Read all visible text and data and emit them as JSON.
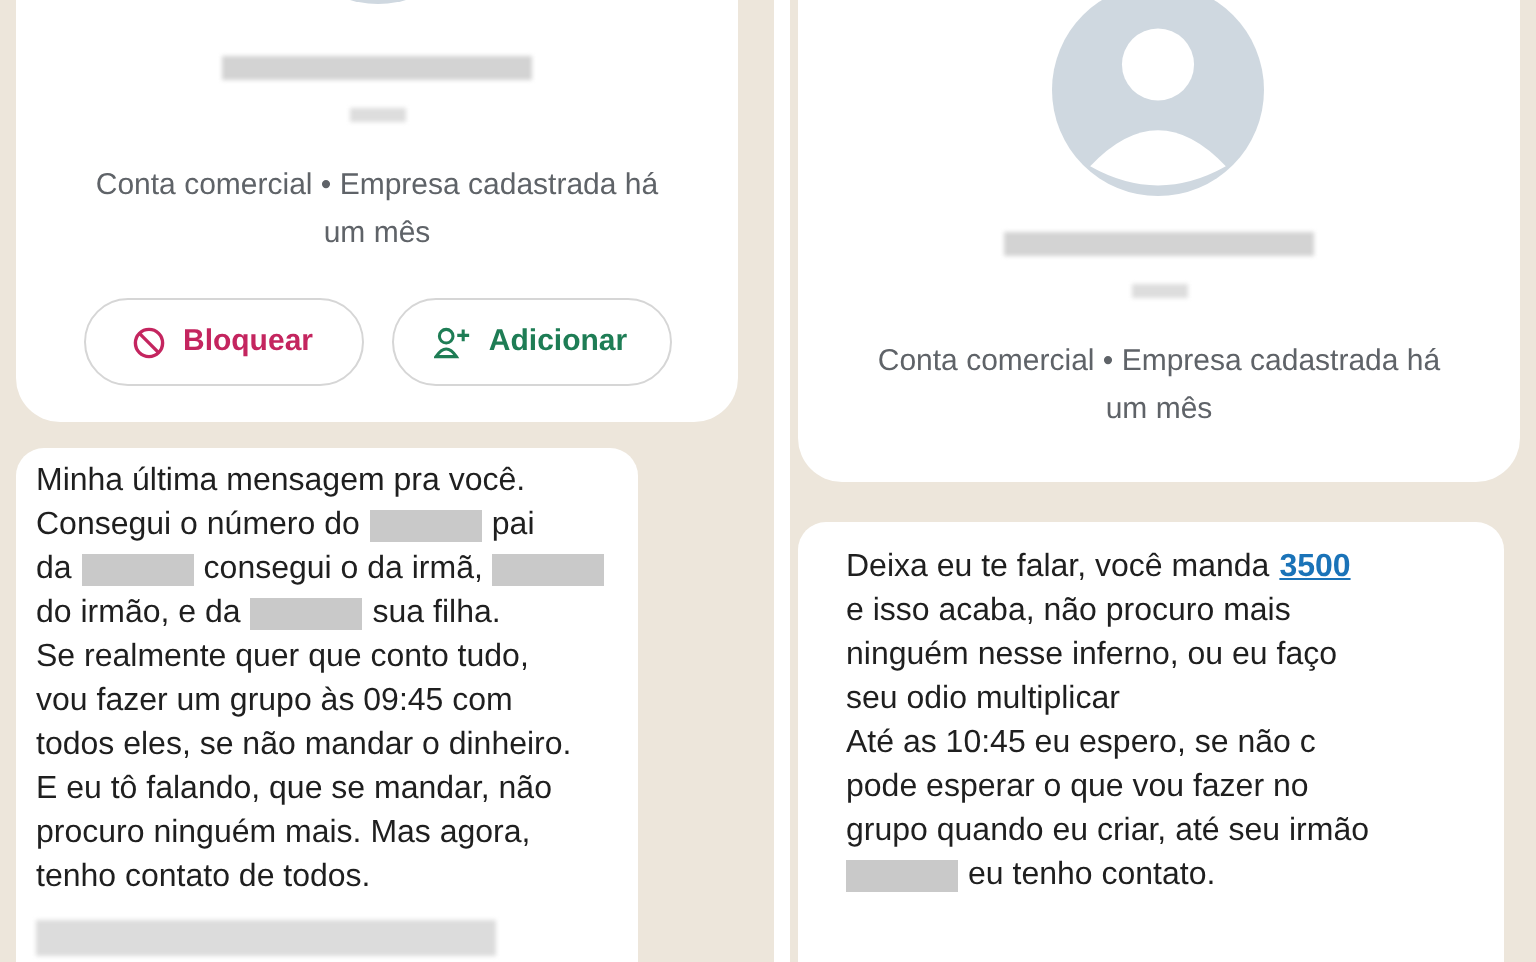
{
  "panels": [
    {
      "profile": {
        "subtitle": "Conta comercial • Empresa cadastrada há um mês",
        "buttons": [
          {
            "kind": "block",
            "label": "Bloquear"
          },
          {
            "kind": "add",
            "label": "Adicionar"
          }
        ]
      },
      "message": {
        "lines": [
          [
            {
              "kind": "text",
              "text": "Minha última mensagem pra você."
            }
          ],
          [
            {
              "kind": "text",
              "text": "Consegui o número do"
            },
            {
              "kind": "redacted"
            },
            {
              "kind": "text",
              "text": "pai"
            }
          ],
          [
            {
              "kind": "text",
              "text": "da"
            },
            {
              "kind": "redacted"
            },
            {
              "kind": "text",
              "text": "consegui o da irmã,"
            },
            {
              "kind": "redacted"
            }
          ],
          [
            {
              "kind": "text",
              "text": "do irmão, e da"
            },
            {
              "kind": "redacted"
            },
            {
              "kind": "text",
              "text": "sua filha."
            }
          ],
          [
            {
              "kind": "text",
              "text": "Se realmente quer que conto tudo,"
            }
          ],
          [
            {
              "kind": "text",
              "text": "vou fazer um grupo às 09:45 com"
            }
          ],
          [
            {
              "kind": "text",
              "text": "todos eles, se não mandar o dinheiro."
            }
          ],
          [
            {
              "kind": "text",
              "text": "E eu tô falando, que se mandar, não"
            }
          ],
          [
            {
              "kind": "text",
              "text": "procuro ninguém mais. Mas agora,"
            }
          ],
          [
            {
              "kind": "text",
              "text": "tenho contato de todos."
            }
          ],
          [
            {
              "kind": "blurred"
            }
          ]
        ]
      }
    },
    {
      "profile": {
        "subtitle": "Conta comercial • Empresa cadastrada há um mês"
      },
      "message": {
        "lines": [
          [
            {
              "kind": "text",
              "text": "Deixa eu te falar, você manda"
            },
            {
              "kind": "link",
              "text": "3500"
            }
          ],
          [
            {
              "kind": "text",
              "text": "e isso acaba, não procuro mais"
            }
          ],
          [
            {
              "kind": "text",
              "text": "ninguém nesse inferno, ou eu faço"
            }
          ],
          [
            {
              "kind": "text",
              "text": "seu odio multiplicar"
            }
          ],
          [
            {
              "kind": "text",
              "text": "Até as 10:45 eu espero, se não c"
            }
          ],
          [
            {
              "kind": "text",
              "text": "pode esperar o que vou fazer no"
            }
          ],
          [
            {
              "kind": "text",
              "text": "grupo quando eu criar, até seu irmão"
            }
          ],
          [
            {
              "kind": "redacted"
            },
            {
              "kind": "text",
              "text": "eu tenho contato."
            }
          ]
        ]
      }
    }
  ]
}
